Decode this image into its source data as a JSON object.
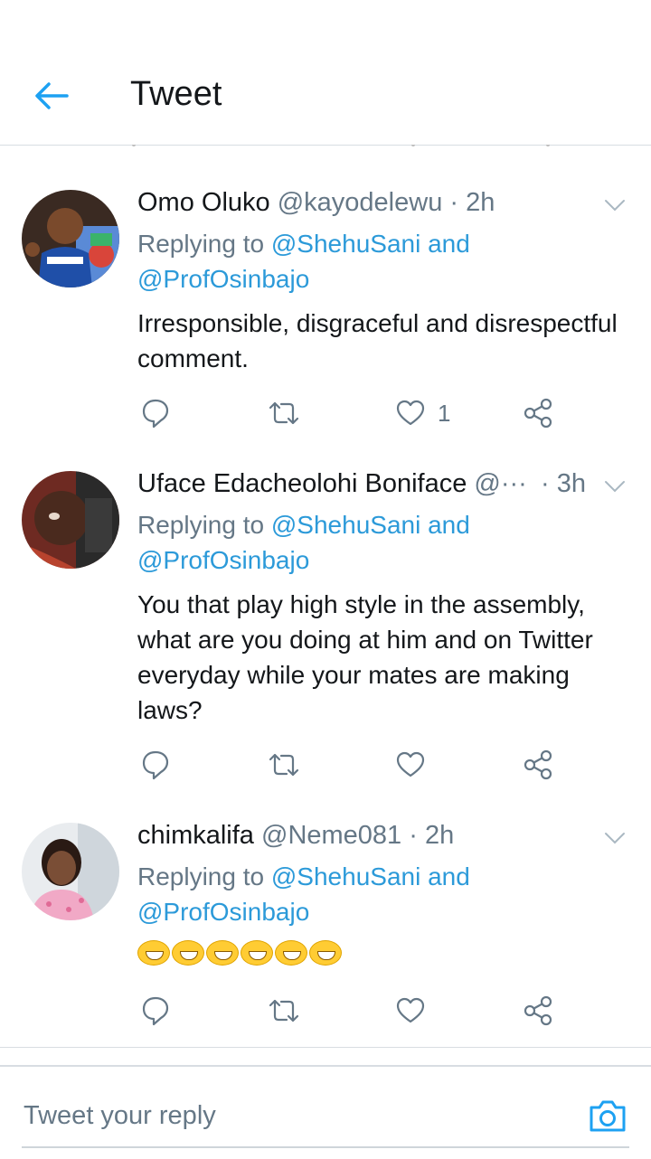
{
  "header": {
    "title": "Tweet"
  },
  "tweets": [
    {
      "name": "Omo Oluko",
      "handle": "@kayodelewu",
      "dot": "·",
      "time": "2h",
      "replying_prefix": "Replying to ",
      "replying_users": "@ShehuSani and @ProfOsinbajo",
      "text": "Irresponsible, disgraceful and disrespectful comment.",
      "like_count": "1"
    },
    {
      "name": "Uface Edacheolohi Boniface",
      "handle": "@···",
      "dot": "·",
      "time": "3h",
      "replying_prefix": "Replying to ",
      "replying_users": "@ShehuSani and @ProfOsinbajo",
      "text": "You that play high style in the assembly, what are you doing at him and on Twitter everyday while your mates are making laws?",
      "like_count": ""
    },
    {
      "name": "chimkalifa",
      "handle": "@Neme081",
      "dot": "·",
      "time": "2h",
      "replying_prefix": "Replying to ",
      "replying_users": "@ShehuSani and @ProfOsinbajo",
      "text": "😁😁😁😁😁😁",
      "like_count": ""
    }
  ],
  "composer": {
    "placeholder": "Tweet your reply"
  },
  "colors": {
    "accent": "#1da1f2",
    "link": "#2c9ad9",
    "muted": "#657786",
    "divider": "#d8dde2"
  },
  "icons": [
    "back-arrow-icon",
    "chevron-down-icon",
    "reply-icon",
    "retweet-icon",
    "like-icon",
    "share-icon",
    "camera-icon"
  ]
}
